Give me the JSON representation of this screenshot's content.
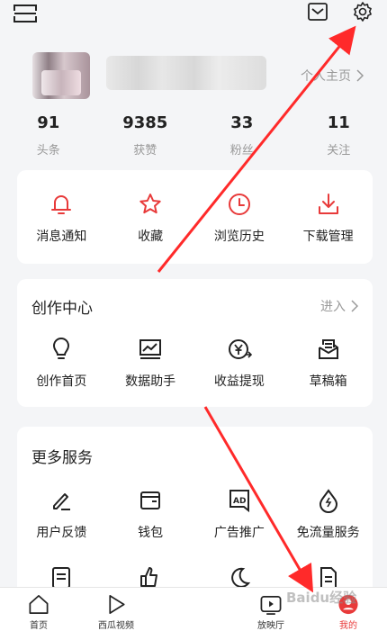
{
  "header": {
    "scan_icon": "scan-icon",
    "mail_icon": "mail-icon",
    "settings_icon": "gear-icon"
  },
  "profile": {
    "homepage_link": "个人主页"
  },
  "stats": [
    {
      "value": "91",
      "label": "头条"
    },
    {
      "value": "9385",
      "label": "获赞"
    },
    {
      "value": "33",
      "label": "粉丝"
    },
    {
      "value": "11",
      "label": "关注"
    }
  ],
  "quick_actions": [
    {
      "label": "消息通知",
      "icon": "bell-icon"
    },
    {
      "label": "收藏",
      "icon": "star-icon"
    },
    {
      "label": "浏览历史",
      "icon": "clock-icon"
    },
    {
      "label": "下载管理",
      "icon": "download-icon"
    }
  ],
  "creation_center": {
    "title": "创作中心",
    "enter": "进入",
    "items": [
      {
        "label": "创作首页",
        "icon": "lightbulb-icon"
      },
      {
        "label": "数据助手",
        "icon": "chart-icon"
      },
      {
        "label": "收益提现",
        "icon": "yen-icon"
      },
      {
        "label": "草稿箱",
        "icon": "drafts-icon"
      }
    ]
  },
  "more_services": {
    "title": "更多服务",
    "items": [
      {
        "label": "用户反馈",
        "icon": "pencil-icon"
      },
      {
        "label": "钱包",
        "icon": "wallet-icon"
      },
      {
        "label": "广告推广",
        "icon": "ad-icon"
      },
      {
        "label": "免流量服务",
        "icon": "data-saver-icon"
      }
    ]
  },
  "bottom_nav": [
    {
      "label": "首页",
      "icon": "home-icon"
    },
    {
      "label": "西瓜视频",
      "icon": "play-icon"
    },
    {
      "label": "",
      "icon": "plus-icon"
    },
    {
      "label": "放映厅",
      "icon": "tv-icon"
    },
    {
      "label": "我的",
      "icon": "profile-icon",
      "active": true
    }
  ],
  "watermark": "Baidu经验",
  "colors": {
    "accent": "#e83a3a",
    "annotation": "#ff2a2a"
  }
}
